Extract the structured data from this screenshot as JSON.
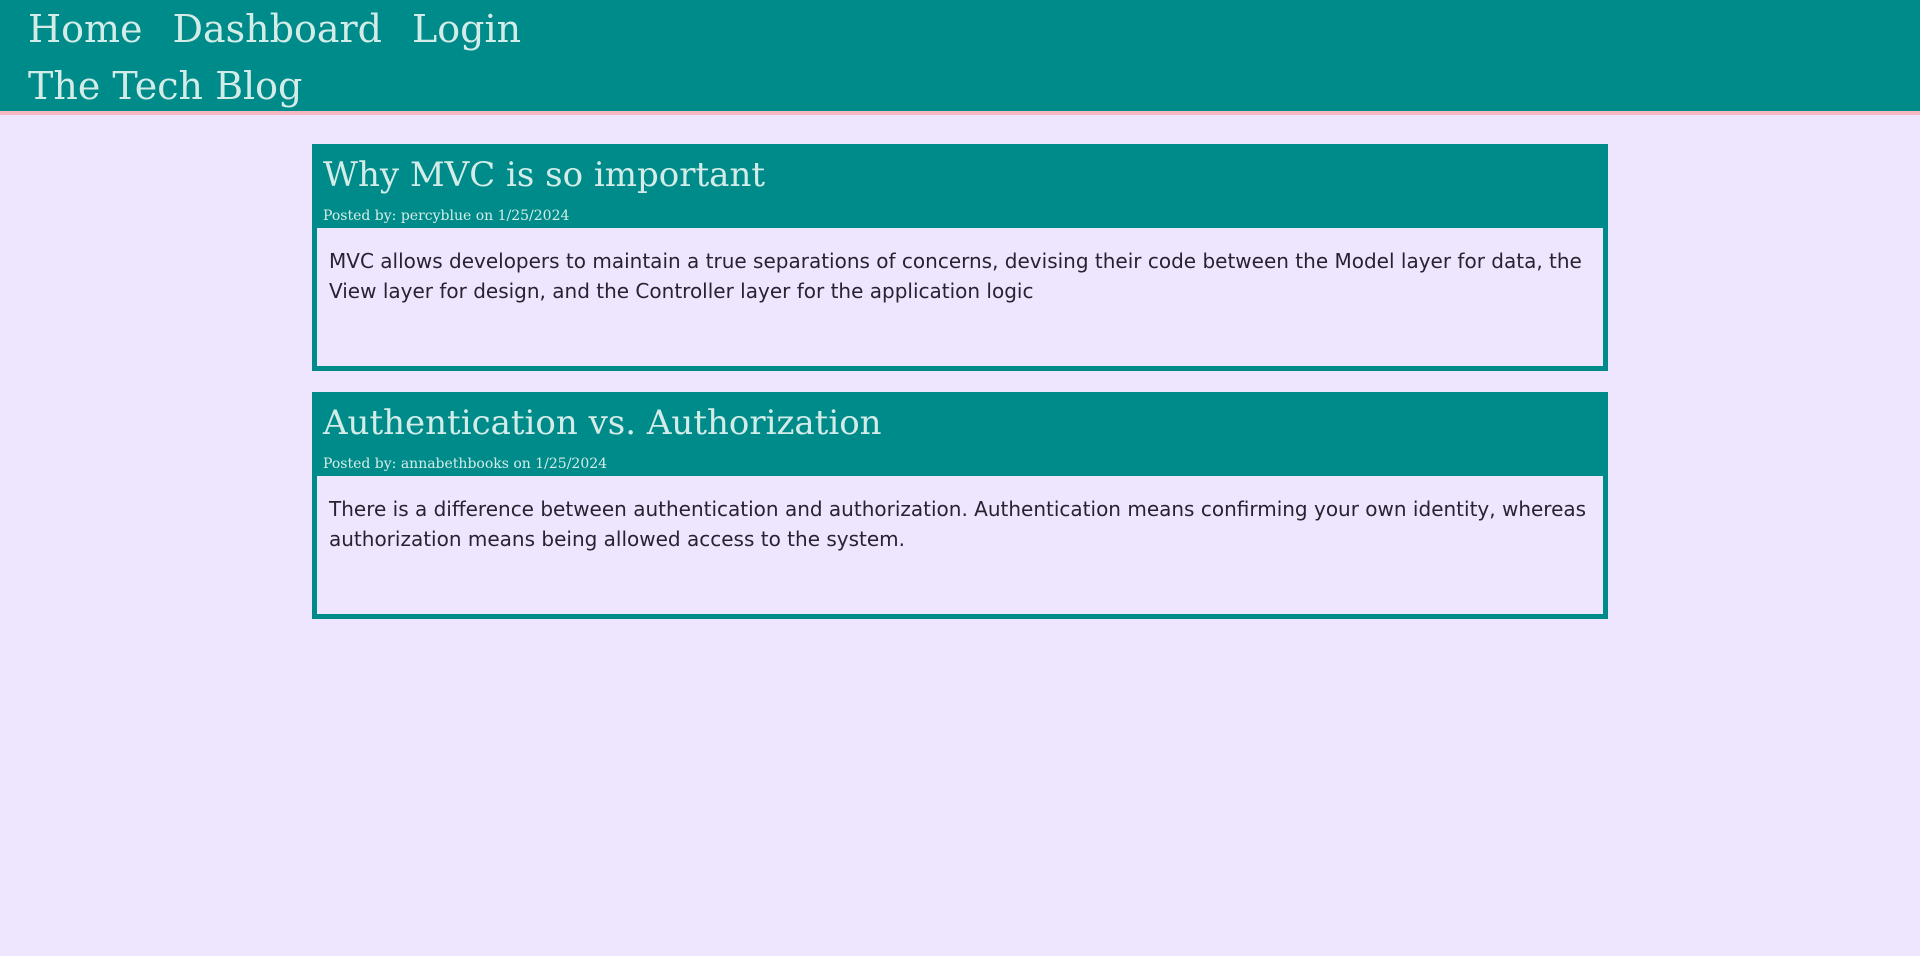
{
  "nav": {
    "home": "Home",
    "dashboard": "Dashboard",
    "login": "Login"
  },
  "site": {
    "title": "The Tech Blog"
  },
  "colors": {
    "header_bg": "#008b8b",
    "page_bg": "#eee6ff",
    "header_border": "#f4b9c3",
    "header_text": "#d4ece8"
  },
  "posts": [
    {
      "title": "Why MVC is so important",
      "meta": "Posted by: percyblue on 1/25/2024",
      "body": "MVC allows developers to maintain a true separations of concerns, devising their code between the Model layer for data, the View layer for design, and the Controller layer for the application logic"
    },
    {
      "title": "Authentication vs. Authorization",
      "meta": "Posted by: annabethbooks on 1/25/2024",
      "body": "There is a difference between authentication and authorization. Authentication means confirming your own identity, whereas authorization means being allowed access to the system."
    }
  ]
}
